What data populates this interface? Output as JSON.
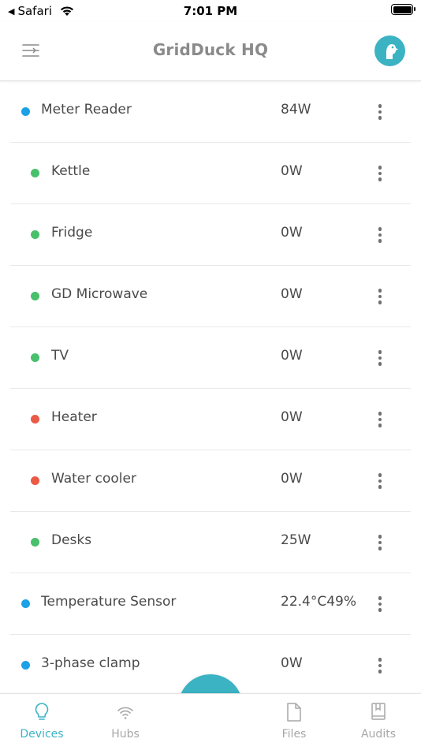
{
  "status_bar": {
    "back_app": "Safari",
    "time": "7:01 PM"
  },
  "header": {
    "title": "GridDuck HQ"
  },
  "colors": {
    "accent": "#3bb3c3",
    "blue_dot": "#1da1e6",
    "green_dot": "#49c06b",
    "red_dot": "#ea5a45"
  },
  "devices": [
    {
      "name": "Meter Reader",
      "value": "84W",
      "status": "blue",
      "level": 0
    },
    {
      "name": "Kettle",
      "value": "0W",
      "status": "green",
      "level": 1
    },
    {
      "name": "Fridge",
      "value": "0W",
      "status": "green",
      "level": 1
    },
    {
      "name": "GD Microwave",
      "value": "0W",
      "status": "green",
      "level": 1
    },
    {
      "name": "TV",
      "value": "0W",
      "status": "green",
      "level": 1
    },
    {
      "name": "Heater",
      "value": "0W",
      "status": "red",
      "level": 1
    },
    {
      "name": "Water cooler",
      "value": "0W",
      "status": "red",
      "level": 1
    },
    {
      "name": "Desks",
      "value": "25W",
      "status": "green",
      "level": 1
    },
    {
      "name": "Temperature Sensor",
      "value": "22.4°C49%",
      "status": "blue",
      "level": 0
    },
    {
      "name": "3-phase clamp",
      "value": "0W",
      "status": "blue",
      "level": 0
    }
  ],
  "tabs": [
    {
      "label": "Devices",
      "icon": "lightbulb-icon",
      "active": true
    },
    {
      "label": "Hubs",
      "icon": "wifi-icon",
      "active": false
    },
    {
      "label": "Files",
      "icon": "file-icon",
      "active": false
    },
    {
      "label": "Audits",
      "icon": "book-icon",
      "active": false
    }
  ],
  "fab": {
    "icon": "plus-icon"
  }
}
